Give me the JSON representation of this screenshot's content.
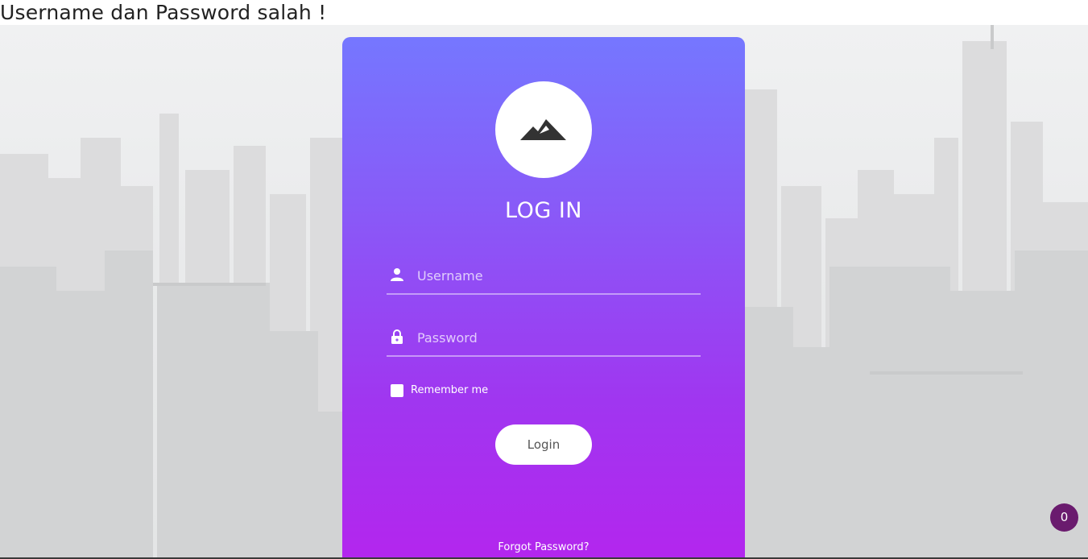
{
  "error": {
    "message": "Username dan Password salah !"
  },
  "login_form": {
    "logo_icon": "mountain-icon",
    "title": "LOG IN",
    "username_placeholder": "Username",
    "username_value": "",
    "username_icon": "user-icon",
    "password_placeholder": "Password",
    "password_value": "",
    "password_icon": "lock-icon",
    "remember_label": "Remember me",
    "remember_checked": false,
    "login_button": "Login",
    "forgot_link": "Forgot Password?"
  },
  "notification_badge": {
    "count": "0",
    "color": "#6a1b6e"
  },
  "colors": {
    "card_gradient_top": "#7577ff",
    "card_gradient_bottom": "#b326ee"
  }
}
